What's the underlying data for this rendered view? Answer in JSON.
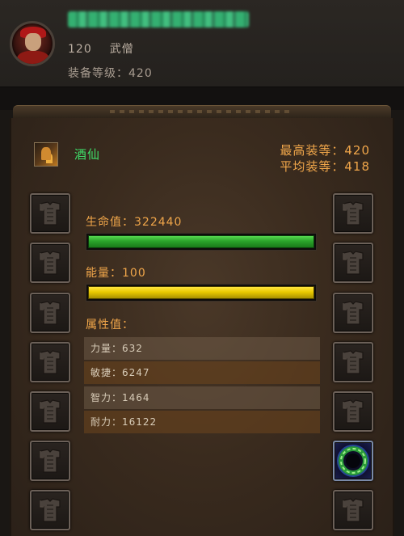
{
  "header": {
    "level": "120",
    "class_name": "武僧",
    "item_level_line": "装备等级：420"
  },
  "spec": {
    "icon": "monk-spec-icon",
    "name": "酒仙"
  },
  "item_level": {
    "max_line": "最高装等：420",
    "avg_line": "平均装等：418"
  },
  "stats": {
    "health_label": "生命值：322440",
    "health_fill": 1.0,
    "health_color": "#2aa42a",
    "energy_label": "能量：100",
    "energy_fill": 1.0,
    "energy_color": "#e8c800",
    "attributes_title": "属性值：",
    "attributes": [
      {
        "label": "力量：632"
      },
      {
        "label": "敏捷：6247"
      },
      {
        "label": "智力：1464"
      },
      {
        "label": "耐力：16122"
      }
    ]
  },
  "slots": {
    "left": [
      "empty-slot-icon",
      "empty-slot-icon",
      "empty-slot-icon",
      "empty-slot-icon",
      "empty-slot-icon",
      "empty-slot-icon",
      "empty-slot-icon"
    ],
    "right": [
      "empty-slot-icon",
      "empty-slot-icon",
      "empty-slot-icon",
      "empty-slot-icon",
      "empty-slot-icon",
      "ring-icon",
      "empty-slot-icon"
    ]
  },
  "colors": {
    "accent_orange": "#f0a64a",
    "spec_green": "#3fe06a",
    "background": "#1a1714"
  }
}
